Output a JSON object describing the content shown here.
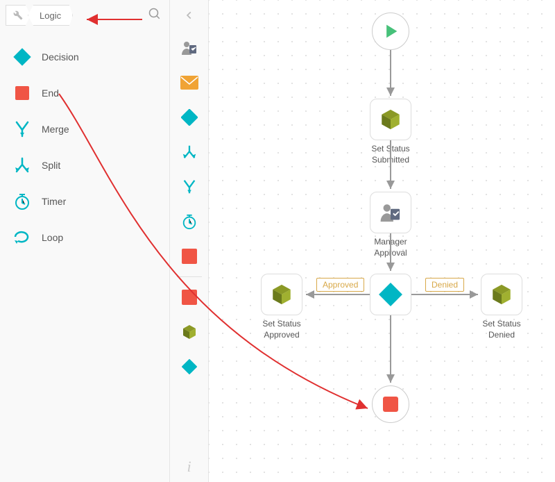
{
  "breadcrumb": {
    "category": "Logic"
  },
  "sidebar_tools": {
    "decision": "Decision",
    "end": "End",
    "merge": "Merge",
    "split": "Split",
    "timer": "Timer",
    "loop": "Loop"
  },
  "mini_icons": [
    "user-task",
    "email",
    "decision",
    "split",
    "merge",
    "timer",
    "end",
    "end-drag",
    "cube",
    "diamond"
  ],
  "colors": {
    "teal": "#00B6C4",
    "red": "#F05545",
    "olive": "#8B9926",
    "orange": "#F0A334",
    "green": "#47C17A",
    "gray": "#999999"
  },
  "chart_data": {
    "type": "flowchart",
    "nodes": [
      {
        "id": "start",
        "type": "start",
        "label": ""
      },
      {
        "id": "n1",
        "type": "activity",
        "label": "Set Status Submitted"
      },
      {
        "id": "n2",
        "type": "user-task",
        "label": "Manager Approval"
      },
      {
        "id": "d1",
        "type": "decision",
        "label": ""
      },
      {
        "id": "n3",
        "type": "activity",
        "label": "Set Status Approved"
      },
      {
        "id": "n4",
        "type": "activity",
        "label": "Set Status Denied"
      },
      {
        "id": "end",
        "type": "end",
        "label": ""
      }
    ],
    "edges": [
      {
        "from": "start",
        "to": "n1",
        "label": ""
      },
      {
        "from": "n1",
        "to": "n2",
        "label": ""
      },
      {
        "from": "n2",
        "to": "d1",
        "label": ""
      },
      {
        "from": "d1",
        "to": "n3",
        "label": "Approved"
      },
      {
        "from": "d1",
        "to": "n4",
        "label": "Denied"
      },
      {
        "from": "d1",
        "to": "end",
        "label": ""
      }
    ],
    "edge_labels": {
      "approved": "Approved",
      "denied": "Denied"
    }
  },
  "annotations": {
    "arrow1": "points breadcrumb to logic category",
    "arrow2": "drag End block onto canvas"
  }
}
